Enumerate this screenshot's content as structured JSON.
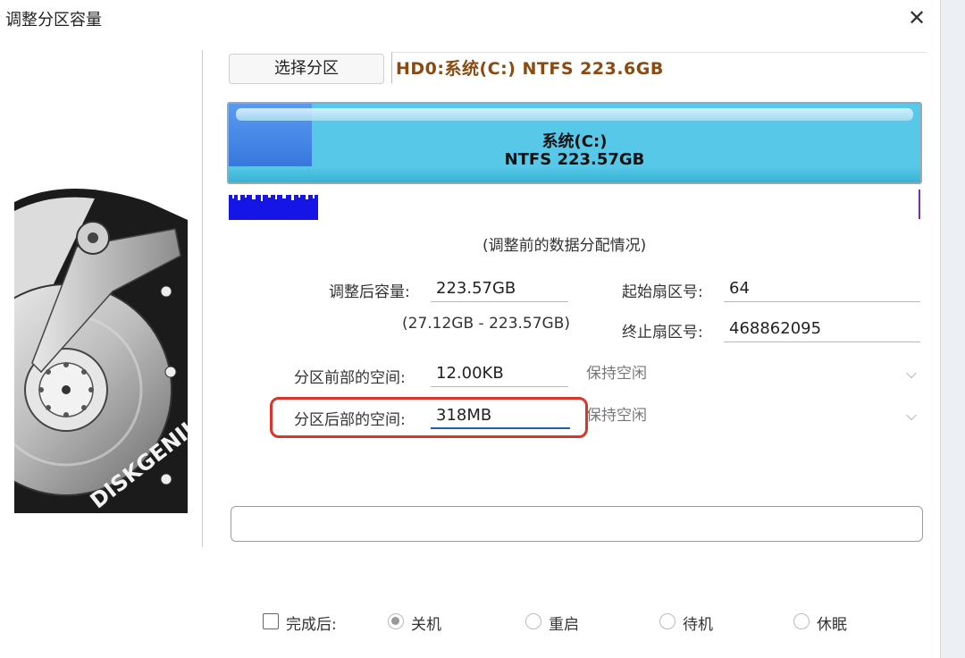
{
  "window": {
    "title": "调整分区容量",
    "close_glyph": "✕"
  },
  "select_partition_button": "选择分区",
  "partition_info": "HD0:系统(C:) NTFS 223.6GB",
  "disk_bar": {
    "name": "系统(C:)",
    "detail": "NTFS 223.57GB",
    "used_fraction": 0.12
  },
  "caption": "(调整前的数据分配情况)",
  "form": {
    "new_size_label": "调整后容量:",
    "new_size_value": "223.57GB",
    "size_range": "(27.12GB - 223.57GB)",
    "start_sector_label": "起始扇区号:",
    "start_sector_value": "64",
    "end_sector_label": "终止扇区号:",
    "end_sector_value": "468862095",
    "front_space_label": "分区前部的空间:",
    "front_space_value": "12.00KB",
    "front_space_option": "保持空闲",
    "back_space_label": "分区后部的空间:",
    "back_space_value": "318MB",
    "back_space_option": "保持空闲"
  },
  "after_completion": {
    "label": "完成后:",
    "options": [
      "关机",
      "重启",
      "待机",
      "休眠"
    ],
    "selected": "关机"
  },
  "colors": {
    "partition_text": "#8a4a10",
    "highlight": "#d8362a",
    "bar": "#58c8e8",
    "used": "#2f6fd8"
  },
  "icons": [
    "close-icon",
    "diskgenius-hdd-illustration",
    "chevron-down-icon"
  ],
  "logo_text": "DISKGENIUS"
}
